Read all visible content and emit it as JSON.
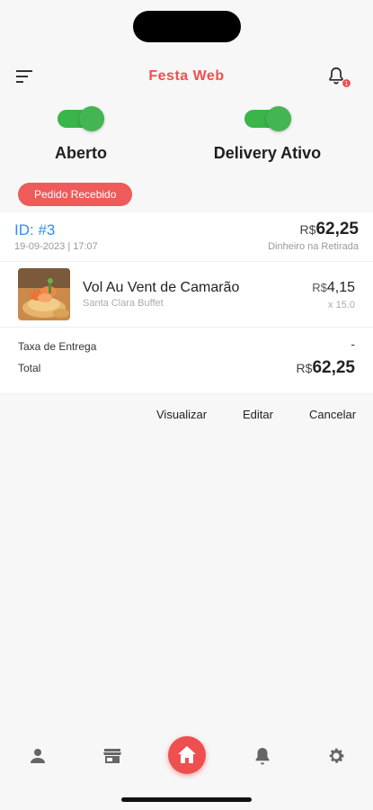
{
  "header": {
    "title": "Festa Web",
    "menu_icon": "filter-list-icon",
    "bell_icon": "bell-icon",
    "bell_badge": "1"
  },
  "toggles": [
    {
      "label": "Aberto",
      "on": true
    },
    {
      "label": "Delivery Ativo",
      "on": true
    }
  ],
  "order": {
    "status": "Pedido Recebido",
    "id": "ID: #3",
    "date": "19-09-2023 | 17:07",
    "currency": "R$",
    "total_amount": "62,25",
    "payment": "Dinheiro na Retirada",
    "item": {
      "name": "Vol Au Vent de Camarão",
      "vendor": "Santa Clara Buffet",
      "currency": "R$",
      "price": "4,15",
      "qty": "x 15.0"
    },
    "fee_label": "Taxa de Entrega",
    "fee_value": "-",
    "total_label": "Total",
    "total_currency": "R$",
    "total_value": "62,25"
  },
  "actions": {
    "view": "Visualizar",
    "edit": "Editar",
    "cancel": "Cancelar"
  },
  "nav": {
    "items": [
      "person-icon",
      "store-icon",
      "home-icon",
      "bell-icon",
      "gear-icon"
    ]
  },
  "colors": {
    "accent": "#ef4f4f",
    "toggle_on": "#44b553",
    "link": "#2a8ff7"
  }
}
